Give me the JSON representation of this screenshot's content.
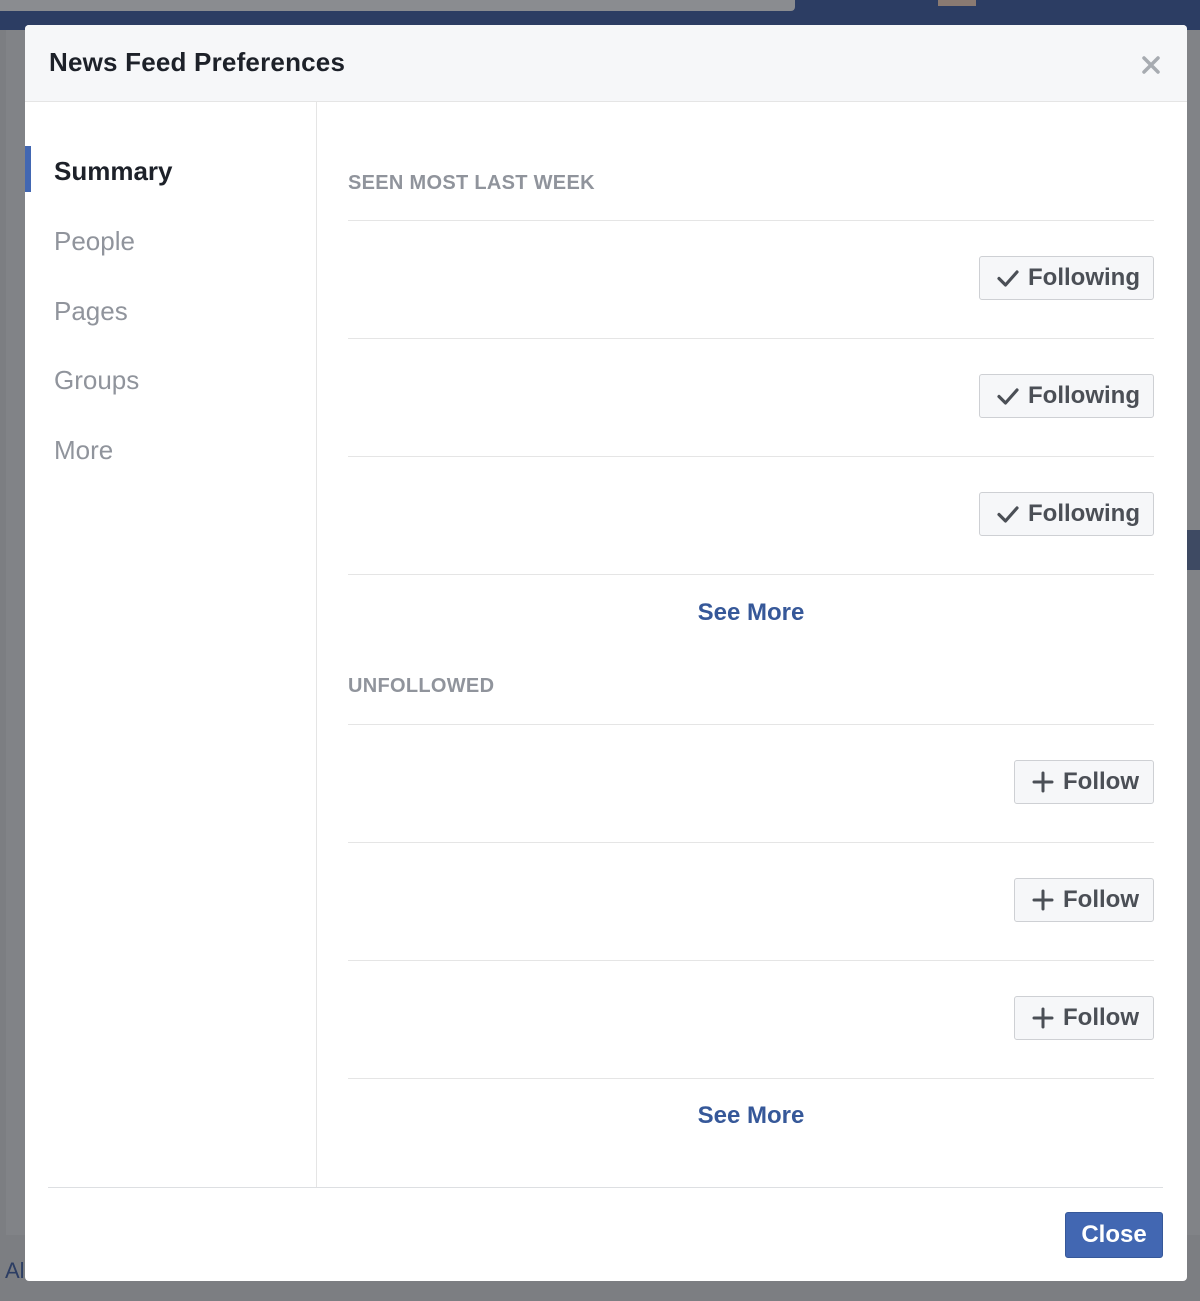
{
  "colors": {
    "accent": "#4267b2",
    "link": "#365899",
    "title_text": "#1d2129",
    "muted_text": "#90949c",
    "button_bg": "#f6f7f9",
    "overlay": "#7c7e82"
  },
  "background": {
    "footer_link_fragment": "Al"
  },
  "modal": {
    "title": "News Feed Preferences",
    "close_icon": "close-x-icon"
  },
  "sidebar": {
    "items": [
      {
        "label": "Summary",
        "active": true
      },
      {
        "label": "People",
        "active": false
      },
      {
        "label": "Pages",
        "active": false
      },
      {
        "label": "Groups",
        "active": false
      },
      {
        "label": "More",
        "active": false
      }
    ]
  },
  "sections": [
    {
      "title": "SEEN MOST LAST WEEK",
      "rows": [
        {
          "button_label": "Following",
          "icon": "checkmark-icon"
        },
        {
          "button_label": "Following",
          "icon": "checkmark-icon"
        },
        {
          "button_label": "Following",
          "icon": "checkmark-icon"
        }
      ],
      "see_more_label": "See More"
    },
    {
      "title": "UNFOLLOWED",
      "rows": [
        {
          "button_label": "Follow",
          "icon": "plus-icon"
        },
        {
          "button_label": "Follow",
          "icon": "plus-icon"
        },
        {
          "button_label": "Follow",
          "icon": "plus-icon"
        }
      ],
      "see_more_label": "See More"
    }
  ],
  "footer": {
    "close_label": "Close"
  }
}
